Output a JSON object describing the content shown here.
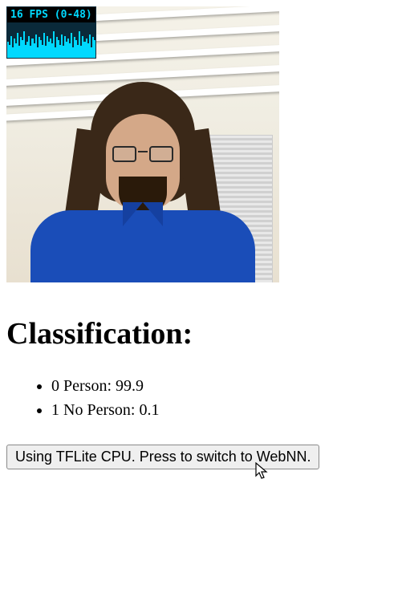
{
  "fps": {
    "label": "16 FPS (0-48)",
    "values": [
      22,
      18,
      30,
      14,
      26,
      20,
      34,
      16,
      28,
      24,
      36,
      18,
      22,
      30,
      16,
      26,
      20,
      32,
      14,
      28,
      24,
      18,
      34,
      16,
      30,
      22,
      26,
      20,
      36,
      14,
      28,
      24,
      18,
      32,
      16,
      30,
      22,
      26,
      20,
      34,
      14,
      28,
      24,
      18,
      36,
      16,
      30,
      22,
      26,
      20,
      32,
      14,
      28,
      24
    ]
  },
  "heading": "Classification:",
  "results": [
    {
      "index": "0",
      "label": "Person",
      "score": "99.9"
    },
    {
      "index": "1",
      "label": "No Person",
      "score": "0.1"
    }
  ],
  "switch_button_label": "Using TFLite CPU. Press to switch to WebNN."
}
